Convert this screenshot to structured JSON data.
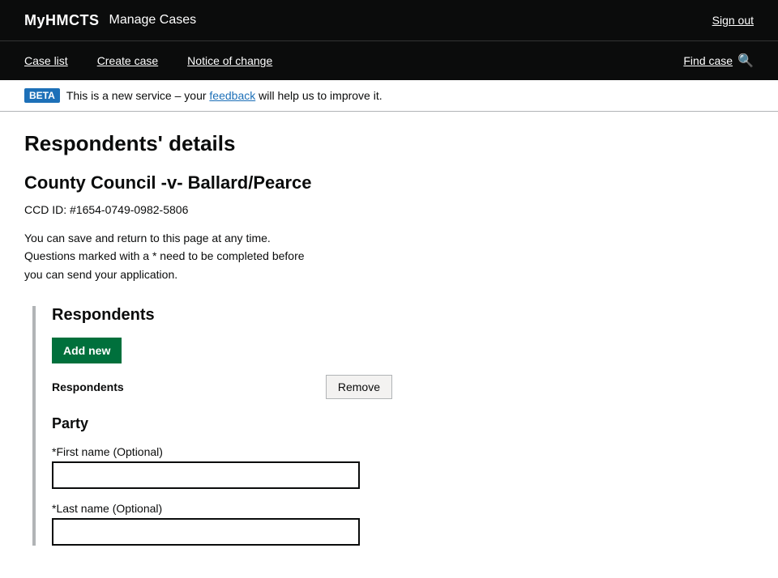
{
  "header": {
    "brand": "MyHMCTS",
    "title": "Manage Cases",
    "signout_label": "Sign out"
  },
  "nav": {
    "links": [
      {
        "label": "Case list",
        "href": "#"
      },
      {
        "label": "Create case",
        "href": "#"
      },
      {
        "label": "Notice of change",
        "href": "#"
      }
    ],
    "find_case": "Find case",
    "search_icon": "🔍"
  },
  "beta_banner": {
    "tag": "BETA",
    "text_before": "This is a new service – your ",
    "feedback_label": "feedback",
    "text_after": " will help us to improve it."
  },
  "page": {
    "title": "Respondents' details",
    "case_title": "County Council -v- Ballard/Pearce",
    "case_id": "CCD ID: #1654-0749-0982-5806",
    "info_line1": "You can save and return to this page at any time.",
    "info_line2": "Questions marked with a * need to be completed before",
    "info_line3": "you can send your application."
  },
  "form": {
    "section_heading": "Respondents",
    "add_new_label": "Add new",
    "respondents_label": "Respondents",
    "remove_label": "Remove",
    "party_heading": "Party",
    "first_name_label": "*First name (Optional)",
    "first_name_placeholder": "",
    "last_name_label": "*Last name (Optional)",
    "last_name_placeholder": ""
  }
}
